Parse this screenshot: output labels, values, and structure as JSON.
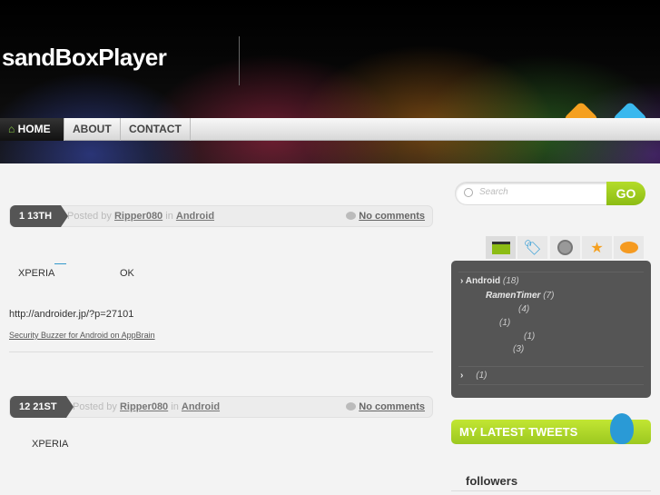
{
  "site": {
    "title": "sandBoxPlayer"
  },
  "nav": [
    {
      "label": "HOME",
      "icon": "home-icon"
    },
    {
      "label": "ABOUT"
    },
    {
      "label": "CONTACT"
    }
  ],
  "posts": [
    {
      "date": "1   13TH",
      "posted_by": "Posted by",
      "author": "Ripper080",
      "in": "in",
      "category": "Android",
      "comments": "No comments",
      "lines": [
        "XPERIA",
        "OK",
        "http://androider.jp/?p=27101",
        "Security Buzzer for Android on AppBrain"
      ]
    },
    {
      "date": "12   21ST",
      "posted_by": "Posted by",
      "author": "Ripper080",
      "in": "in",
      "category": "Android",
      "comments": "No comments",
      "lines": [
        "XPERIA"
      ]
    }
  ],
  "sidebar": {
    "search": {
      "placeholder": "Search",
      "go": "GO"
    },
    "tabs": [
      "folder-icon",
      "tag-icon",
      "clock-icon",
      "star-icon",
      "comment-icon"
    ],
    "categories": [
      {
        "name": "Android",
        "count": "(18)"
      },
      {
        "name": "RamenTimer",
        "count": "(7)"
      },
      {
        "name": "",
        "count": "(4)"
      },
      {
        "name": "",
        "count": "(1)"
      },
      {
        "name": "",
        "count": "(1)"
      },
      {
        "name": "",
        "count": "(3)"
      },
      {
        "name": "",
        "count": "(1)"
      }
    ],
    "tweets_title": "MY LATEST TWEETS",
    "followers": "followers"
  },
  "colors": {
    "accent": "#9cc820",
    "dark": "#555555"
  }
}
